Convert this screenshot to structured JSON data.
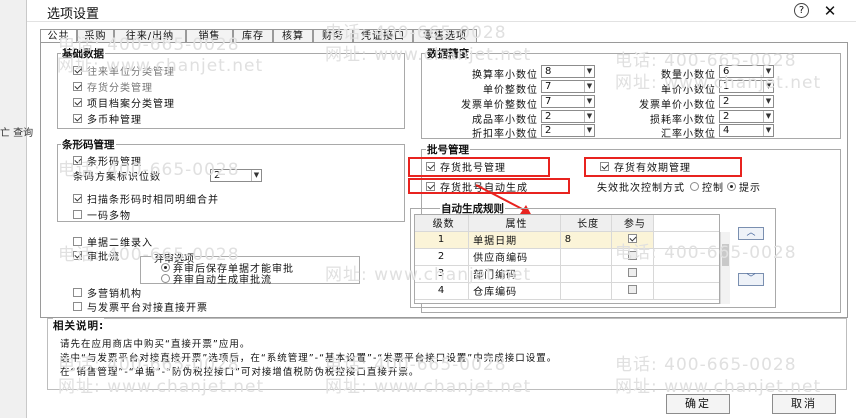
{
  "window": {
    "title": "选项设置",
    "help": "?",
    "close": "✕"
  },
  "leftstrip": {
    "text": "亡 查询"
  },
  "tabs": [
    "公共",
    "采购",
    "往来/出纳",
    "销售",
    "库存",
    "核算",
    "财务",
    "凭证接口",
    "零售选项"
  ],
  "basic": {
    "title": "基础数据",
    "items": [
      {
        "label": "往来单位分类管理",
        "checked": true
      },
      {
        "label": "存货分类管理",
        "checked": true
      },
      {
        "label": "项目档案分类管理",
        "checked": true
      },
      {
        "label": "多币种管理",
        "checked": true
      }
    ]
  },
  "barcode": {
    "title": "条形码管理",
    "enable": {
      "label": "条形码管理",
      "checked": true
    },
    "digit_label": "条码方案标识位数",
    "digit_value": "2",
    "scan": {
      "label": "扫描条形码时相同明细合并",
      "checked": true
    },
    "multi": {
      "label": "一码多物",
      "checked": false
    }
  },
  "misc": {
    "qr": {
      "label": "单据二维录入",
      "checked": false
    },
    "approval": {
      "label": "审批流",
      "checked": true
    },
    "approval_sub_label": "弃审选项",
    "approval_options": [
      {
        "label": "弃审后保存单据才能审批",
        "selected": true
      },
      {
        "label": "弃审自动生成审批流",
        "selected": false
      }
    ],
    "multi_sales": {
      "label": "多营销机构",
      "checked": false
    },
    "invoice_platform": {
      "label": "与发票平台对接直接开票",
      "checked": false
    }
  },
  "precision": {
    "title": "数据精度",
    "rows": [
      {
        "left_label": "换算率小数位",
        "left_value": "8",
        "right_label": "数量小数位",
        "right_value": "6"
      },
      {
        "left_label": "单价整数位",
        "left_value": "7",
        "right_label": "单价小数位",
        "right_value": "1"
      },
      {
        "left_label": "发票单价整数位",
        "left_value": "7",
        "right_label": "发票单价小数位",
        "right_value": "2"
      },
      {
        "left_label": "成品率小数位",
        "left_value": "2",
        "right_label": "损耗率小数位",
        "right_value": "2"
      },
      {
        "left_label": "折扣率小数位",
        "left_value": "2",
        "right_label": "汇率小数位",
        "right_value": "4"
      }
    ]
  },
  "batch": {
    "title": "批号管理",
    "batch_manage": {
      "label": "存货批号管理",
      "checked": true
    },
    "expiry_manage": {
      "label": "存货有效期管理",
      "checked": true
    },
    "auto_batch": {
      "label": "存货批号自动生成",
      "checked": true
    },
    "expiry_control_label": "失效批次控制方式",
    "expiry_control_options": [
      {
        "label": "控制",
        "selected": false
      },
      {
        "label": "提示",
        "selected": true
      }
    ],
    "rule_title": "自动生成规则",
    "rule_columns": [
      "级数",
      "属性",
      "长度",
      "参与"
    ],
    "rule_rows": [
      {
        "level": "1",
        "attr": "单据日期",
        "length": "8",
        "participate": true
      },
      {
        "level": "2",
        "attr": "供应商编码",
        "length": "",
        "participate": false
      },
      {
        "level": "3",
        "attr": "部门编码",
        "length": "",
        "participate": false
      },
      {
        "level": "4",
        "attr": "仓库编码",
        "length": "",
        "participate": false
      }
    ],
    "up_btn": "︿",
    "down_btn": "﹀"
  },
  "description": {
    "title": "相关说明:",
    "lines": [
      "请先在应用商店中购买“直接开票”应用。",
      "选中“与发票平台对接直接开票”选项后，在“系统管理”-“基本设置”-“发票平台接口设置”中完成接口设置。",
      "在“销售管理”-“单据”-“防伪税控接口”可对接增值税防伪税控接口直接开票。"
    ]
  },
  "buttons": {
    "ok": "确定",
    "cancel": "取消"
  },
  "watermark": {
    "phone": "电话: 400-665-0028",
    "site": "网址: www.chanjet.net"
  },
  "colors": {
    "highlight_red": "#e8231f",
    "row_highlight": "#fbf4d8"
  }
}
